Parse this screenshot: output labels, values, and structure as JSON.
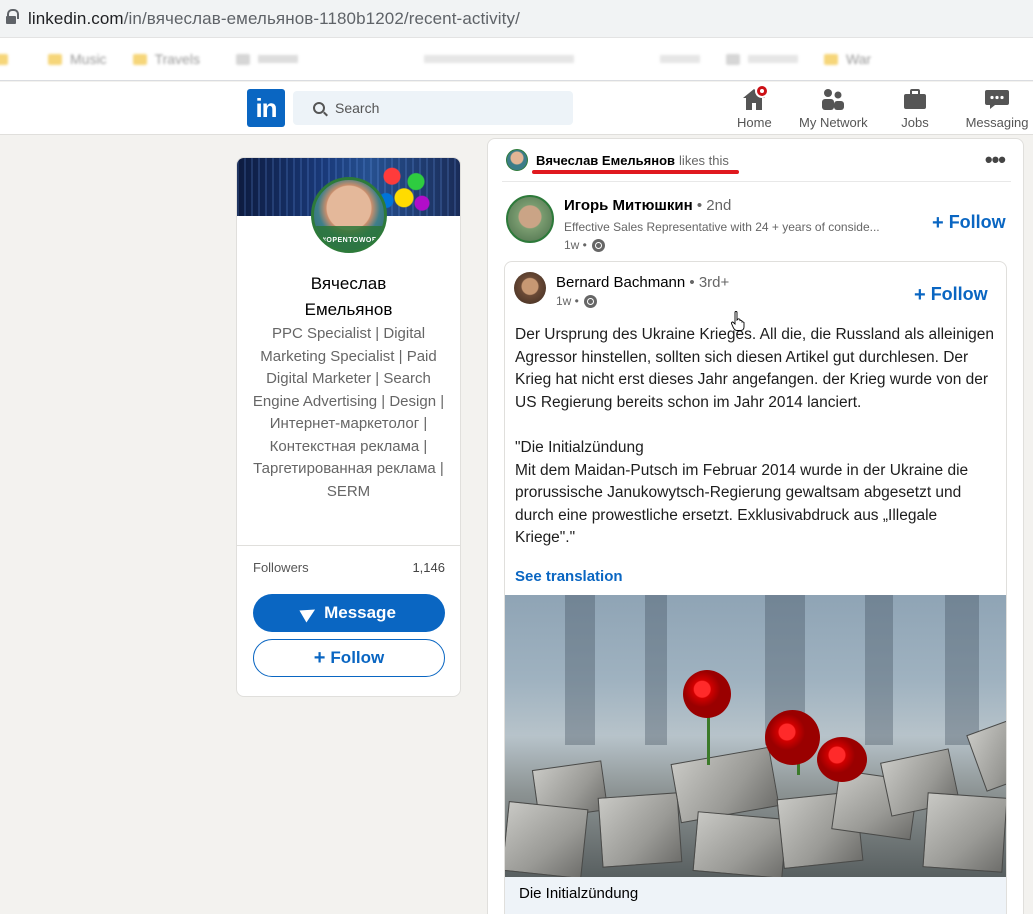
{
  "browser": {
    "url_host": "linkedin.com",
    "url_path": "/in/вячеслав-емельянов-1180b1202/recent-activity/",
    "bookmarks": [
      "Music",
      "Travels",
      "",
      "War"
    ]
  },
  "nav": {
    "logo": "in",
    "search_placeholder": "Search",
    "items": [
      {
        "label": "Home",
        "icon": "home-icon"
      },
      {
        "label": "My Network",
        "icon": "network-icon"
      },
      {
        "label": "Jobs",
        "icon": "briefcase-icon"
      },
      {
        "label": "Messaging",
        "icon": "messaging-icon"
      }
    ]
  },
  "profile": {
    "name": "Вячеслав Емельянов",
    "avatar_ring_text": "#OPENTOWORK",
    "headline": "PPC Specialist | Digital Marketing Specialist | Paid Digital Marketer | Search Engine Advertising | Design | Интернет-маркетолог | Контекстная реклама | Таргетированная реклама | SERM",
    "followers_label": "Followers",
    "followers_count": "1,146",
    "message_label": "Message",
    "follow_label": "Follow"
  },
  "feed": {
    "liker_name": "Вячеслав Емельянов",
    "liker_verb": "likes this",
    "more_icon": "•••",
    "actor": {
      "name": "Игорь Митюшкин",
      "degree": "• 2nd",
      "subtitle": "Effective Sales Representative with 24 + years of conside...",
      "time": "1w •",
      "follow_label": "Follow"
    },
    "shared": {
      "name": "Bernard Bachmann",
      "degree": "• 3rd+",
      "time": "1w •",
      "follow_label": "Follow",
      "text": "Der Ursprung des Ukraine Krieges. All die, die Russland als alleinigen Agressor hinstellen, sollten sich diesen Artikel gut durchlesen. Der Krieg hat nicht erst dieses Jahr angefangen. der Krieg wurde von der US Regierung bereits schon im Jahr 2014 lanciert.\n\n\"Die Initialzündung\nMit dem Maidan-Putsch im Februar 2014 wurde in der Ukraine die prorussische Janukowytsch-Regierung gewaltsam abgesetzt und durch eine prowestliche ersetzt. Exklusivabdruck aus „Illegale Kriege\".\"",
      "see_translation": "See translation",
      "image_caption": "Die Initialzündung"
    }
  },
  "colors": {
    "linkedin_blue": "#0a66c2",
    "page_bg": "#f3f2ef",
    "notification_red": "#cc1016",
    "annotation_red": "#e0191f"
  }
}
